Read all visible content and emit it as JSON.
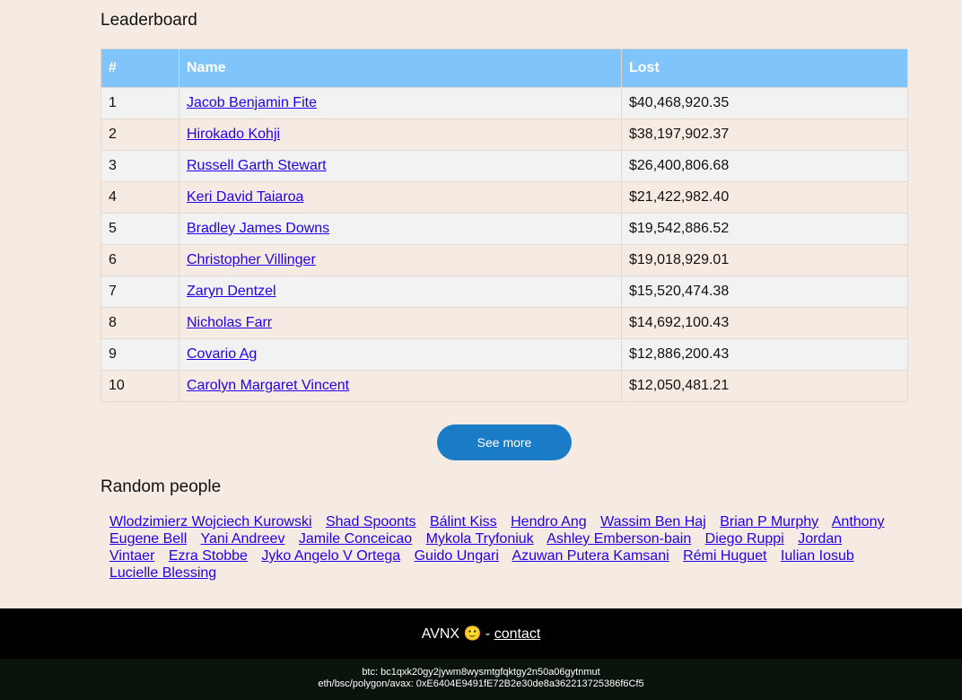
{
  "leaderboard": {
    "title": "Leaderboard",
    "headers": [
      "#",
      "Name",
      "Lost"
    ],
    "rows": [
      [
        "1",
        "Jacob Benjamin Fite",
        "$40,468,920.35"
      ],
      [
        "2",
        "Hirokado Kohji",
        "$38,197,902.37"
      ],
      [
        "3",
        "Russell Garth Stewart",
        "$26,400,806.68"
      ],
      [
        "4",
        "Keri David Taiaroa",
        "$21,422,982.40"
      ],
      [
        "5",
        "Bradley James Downs",
        "$19,542,886.52"
      ],
      [
        "6",
        "Christopher Villinger",
        "$19,018,929.01"
      ],
      [
        "7",
        "Zaryn Dentzel",
        "$15,520,474.38"
      ],
      [
        "8",
        "Nicholas Farr",
        "$14,692,100.43"
      ],
      [
        "9",
        "Covario Ag",
        "$12,886,200.43"
      ],
      [
        "10",
        "Carolyn Margaret Vincent",
        "$12,050,481.21"
      ]
    ],
    "see_more": "See more"
  },
  "random": {
    "title": "Random people",
    "people": [
      "Wlodzimierz Wojciech Kurowski",
      "Shad Spoonts",
      "Bálint Kiss",
      "Hendro Ang",
      "Wassim Ben Haj",
      "Brian P Murphy",
      "Anthony Eugene Bell",
      "Yani Andreev",
      "Jamile Conceicao",
      "Mykola Tryfoniuk",
      "Ashley Emberson-bain",
      "Diego Ruppi",
      "Jordan Vintaer",
      "Ezra Stobbe",
      "Jyko Angelo V Ortega",
      "Guido Ungari",
      "Azuwan Putera Kamsani",
      "Rémi Huguet",
      "Iulian Iosub",
      "Lucielle Blessing"
    ]
  },
  "footer": {
    "brand": "AVNX 🙂 - ",
    "contact": "contact",
    "btc": "btc: bc1qxk20gy2jywm8wysmtgfqktgy2n50a06gytnmut",
    "eth": "eth/bsc/polygon/avax: 0xE6404E9491fE72B2e30de8a362213725386f6Cf5"
  }
}
